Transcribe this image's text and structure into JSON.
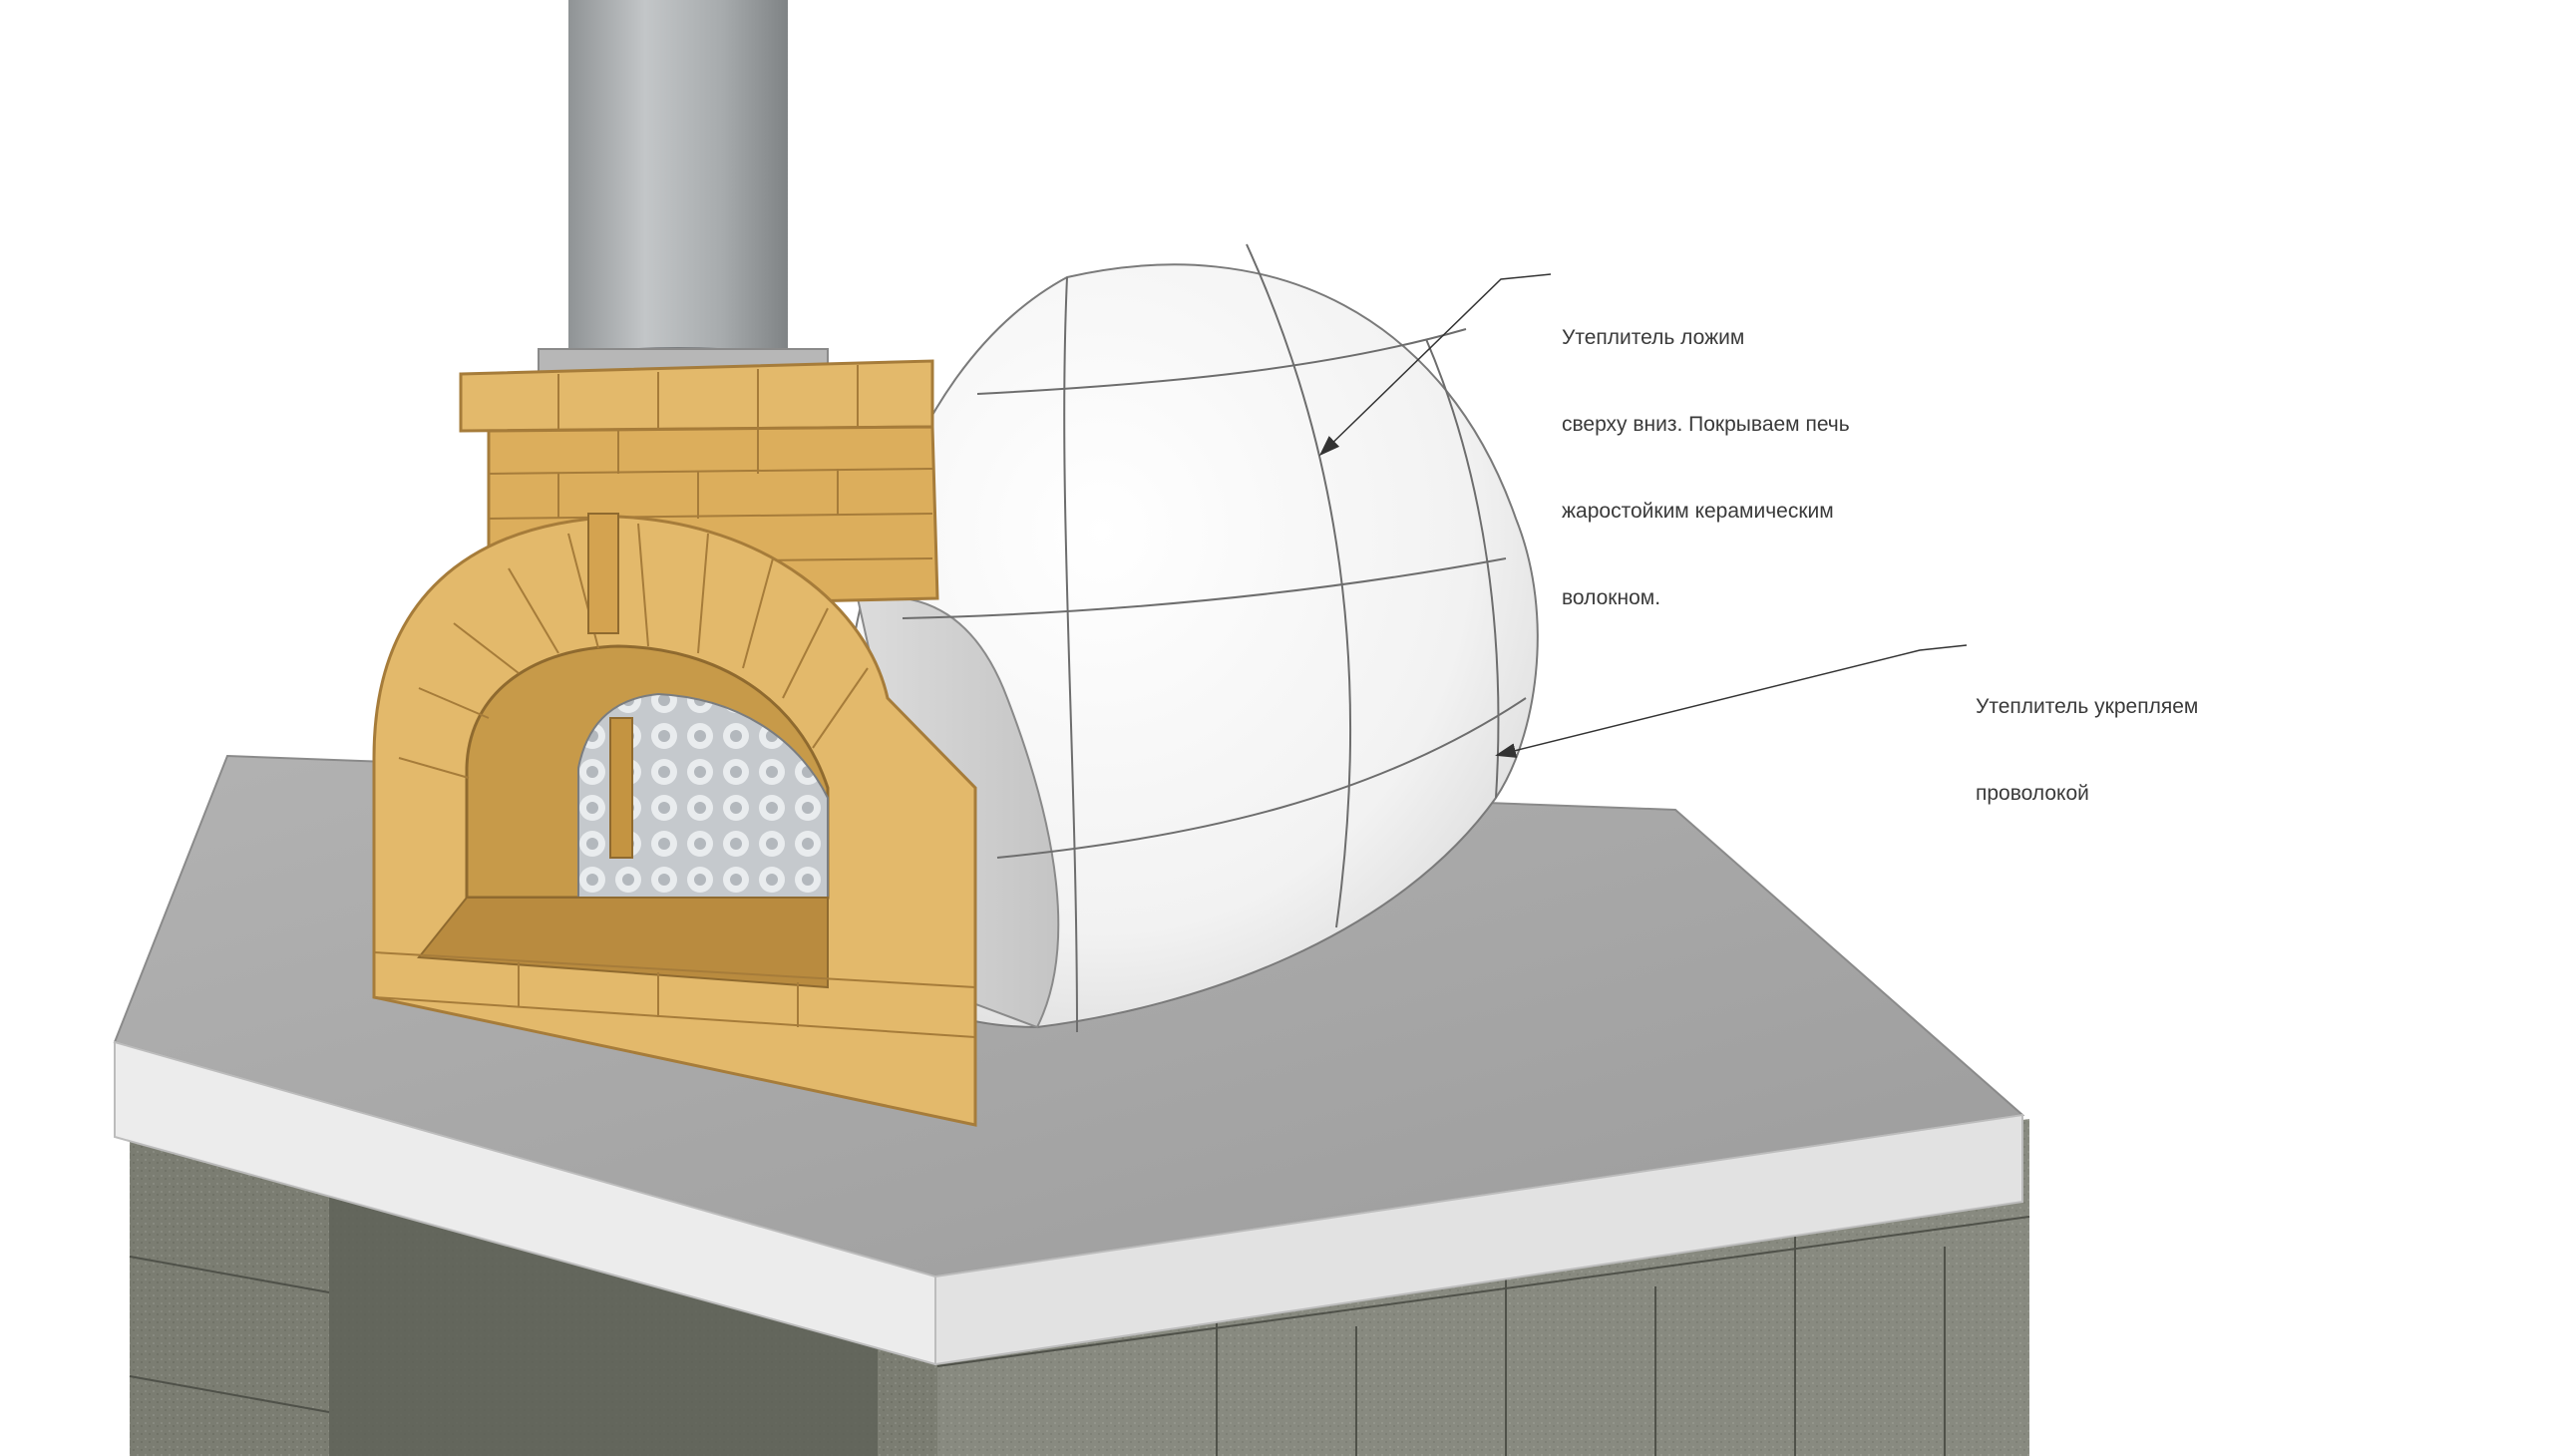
{
  "annotations": {
    "insulation_top": {
      "lines": [
        "Утеплитель ложим",
        "сверху вниз. Покрываем печь",
        "жаростойким керамическим",
        "волокном."
      ]
    },
    "insulation_wire": {
      "lines": [
        "Утеплитель укрепляем",
        "проволокой"
      ]
    }
  },
  "colors": {
    "brick": "#e3b96b",
    "brick_mortar": "#a67c3a",
    "dome": "#f4f4f4",
    "dome_shadow": "#c9c9c9",
    "slab_top": "#a9a9a9",
    "slab_edge": "#e8e8e8",
    "block_wall": "#7d7f74",
    "chimney_pipe": "#a9acae",
    "foil": "#c8ccd0"
  },
  "icons": [
    "leader-arrow"
  ]
}
